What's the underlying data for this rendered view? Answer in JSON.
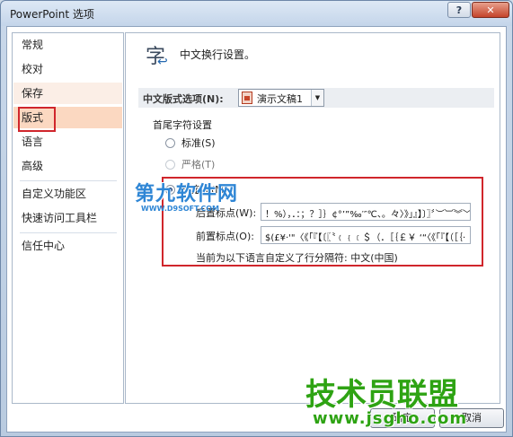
{
  "window": {
    "title": "PowerPoint 选项",
    "help_label": "?",
    "close_label": "✕"
  },
  "sidebar": {
    "items": [
      {
        "label": "常规"
      },
      {
        "label": "校对"
      },
      {
        "label": "保存"
      },
      {
        "label": "版式"
      },
      {
        "label": "语言"
      },
      {
        "label": "高级"
      },
      {
        "label": "自定义功能区"
      },
      {
        "label": "快速访问工具栏"
      },
      {
        "label": "信任中心"
      }
    ],
    "selected": "版式"
  },
  "main": {
    "header_title": "中文换行设置。",
    "header_icon_glyph": "字",
    "options_label": "中文版式选项(N):",
    "document_select_value": "演示文稿1",
    "section_title": "首尾字符设置",
    "radio_options": [
      {
        "label": "标准(S)",
        "checked": false,
        "enabled": true
      },
      {
        "label": "严格(T)",
        "checked": false,
        "enabled": false
      },
      {
        "label": "自定义(M)",
        "checked": true,
        "enabled": true
      }
    ],
    "custom": {
      "following_label": "后置标点(W):",
      "following_value": "！%），．：；？］｝¢°’”‰′″℃、。々〉》」』】〕〗〞︶︺︾﹀﹄﹚﹜﹞！＂％＇），．：；？］｝～￠ ―˙¨〃々～‖…’”〕〉》」』】：!",
      "leading_label": "前置标点(O):",
      "leading_value": "$(£¥·'\"〈《「『【〔〖〝﹙﹛﹝＄（．［｛￡￥ ‘“〈《「『【（［｛·",
      "status_text": "当前为以下语言自定义了行分隔符: 中文(中国)"
    }
  },
  "buttons": {
    "ok_label": "确定",
    "cancel_label": "取消"
  },
  "watermarks": {
    "top_text": "第九软件网",
    "top_url": "WWW.D9SOFT.COM",
    "bottom_text": "技术员联盟",
    "bottom_url": "www.jsgho.com"
  },
  "colors": {
    "selected_nav": "#fbd8c1",
    "highlight_red": "#d0262c",
    "watermark_blue": "#2f86d5",
    "watermark_green": "#2ea313"
  }
}
